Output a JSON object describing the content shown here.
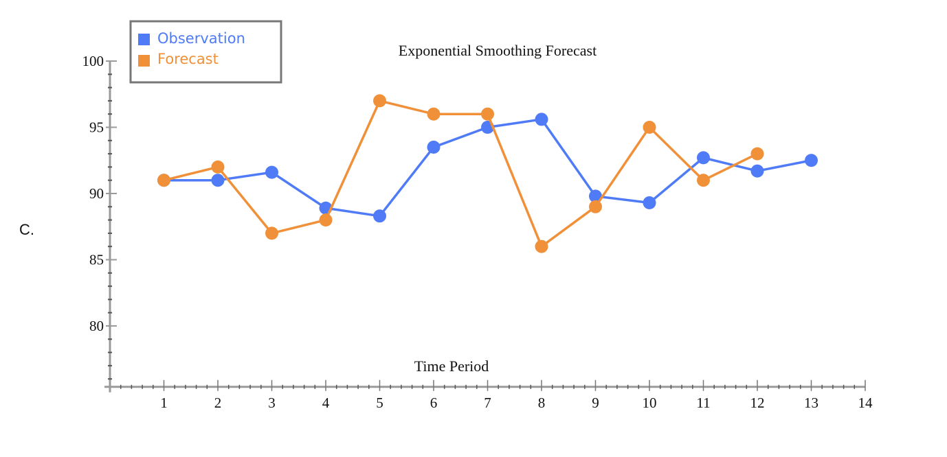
{
  "question_label": "C.",
  "chart_data": {
    "type": "line",
    "title": "Exponential Smoothing Forecast",
    "xlabel": "Time Period",
    "ylabel": "",
    "xlim": [
      0,
      14
    ],
    "ylim": [
      75.4,
      100
    ],
    "x_ticks": [
      1,
      2,
      3,
      4,
      5,
      6,
      7,
      8,
      9,
      10,
      11,
      12,
      13,
      14
    ],
    "y_ticks": [
      80,
      85,
      90,
      95,
      100
    ],
    "x_minor_step": 0.2,
    "y_minor_step": 1,
    "grid": false,
    "legend": {
      "position": "top-left"
    },
    "series": [
      {
        "name": "Observation",
        "color": "#4f7bf7",
        "x": [
          1,
          2,
          3,
          4,
          5,
          6,
          7,
          8,
          9,
          10,
          11,
          12,
          13
        ],
        "values": [
          91,
          91,
          91.6,
          88.9,
          88.3,
          93.5,
          95,
          95.6,
          89.8,
          89.3,
          92.7,
          91.7,
          92.5
        ]
      },
      {
        "name": "Forecast",
        "color": "#f0913a",
        "x": [
          1,
          2,
          3,
          4,
          5,
          6,
          7,
          8,
          9,
          10,
          11,
          12
        ],
        "values": [
          91,
          92,
          87,
          88,
          97,
          96,
          96,
          86,
          89,
          95,
          91,
          93
        ]
      }
    ]
  }
}
